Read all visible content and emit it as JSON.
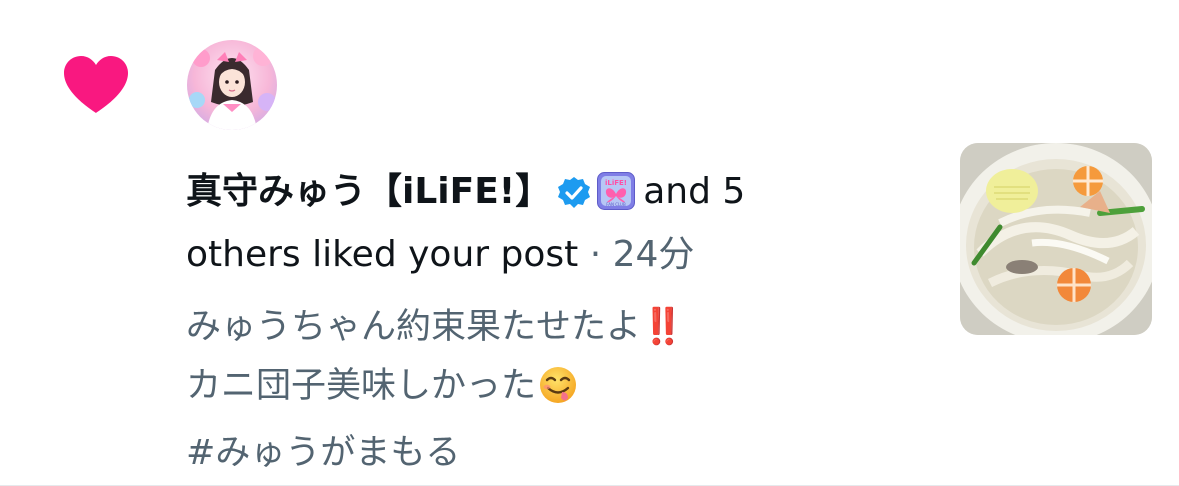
{
  "notification": {
    "type_icon": "heart-icon",
    "accent_color": "#f91880",
    "actor": {
      "name": "真守みゅう【iLiFE!】",
      "verified_icon": "verified-badge-icon",
      "verified_color": "#1d9bf0",
      "affiliate_icon": "ilife-affiliate-badge-icon"
    },
    "summary_part1": "and 5",
    "summary_part2": "others liked your post",
    "separator": "·",
    "time": "24分",
    "post": {
      "line1": "みゅうちゃん約束果たせたよ",
      "line1_emoji": "‼️",
      "line2": "カニ団子美味しかった",
      "line2_emoji": "😋",
      "line3": "#みゅうがまもる"
    },
    "thumbnail": "soup-photo"
  }
}
